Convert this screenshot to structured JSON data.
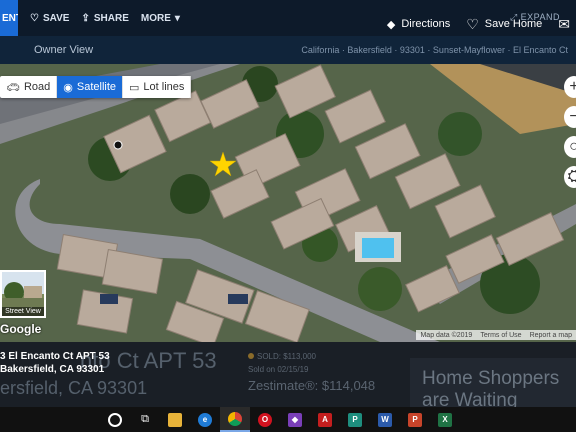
{
  "topbar": {
    "selected_tab": "ENT",
    "tabs": [
      {
        "label": "SAVE",
        "icon": "heart-outline-icon"
      },
      {
        "label": "SHARE",
        "icon": "share-icon"
      },
      {
        "label": "MORE",
        "icon": "chevron-down-icon"
      }
    ],
    "expand_label": "EXPAND",
    "directions_label": "Directions",
    "save_home_label": "Save Home"
  },
  "subbar": {
    "owner_view_label": "Owner View",
    "crumbs": "California · Bakersfield · 93301 · Sunset-Mayflower · El Encanto Ct"
  },
  "map": {
    "map_types": [
      {
        "label": "Road",
        "icon": "car-icon",
        "active": false
      },
      {
        "label": "Satellite",
        "icon": "eye-icon",
        "active": true
      },
      {
        "label": "Lot lines",
        "icon": "lot-lines-icon",
        "active": false
      }
    ],
    "street_view_label": "Street View",
    "google_label": "Google",
    "attribution": [
      "Map data ©2019",
      "Terms of Use",
      "Report a map"
    ]
  },
  "listing": {
    "address_line1": "3 El Encanto Ct APT 53",
    "address_line2": "Bakersfield, CA 93301",
    "headline": "nto Ct APT 53",
    "city_line": "ersfield, CA 93301",
    "sold_label": "SOLD: $113,000",
    "sold_date": "Sold on 02/15/19",
    "zestimate": "Zestimate®: $114,048",
    "shoppers": "Home Shoppers are Waiting"
  },
  "taskbar": {
    "apps": [
      "cortana-icon",
      "task-view-icon",
      "file-explorer-icon",
      "edge-icon",
      "chrome-icon",
      "opera-icon",
      "visual-studio-icon",
      "acrobat-icon",
      "powerpoint-icon",
      "word-icon",
      "powerpoint-icon-2",
      "excel-icon"
    ]
  },
  "colors": {
    "accent": "#1a6bd6",
    "topbar_bg": "#0d1a2a",
    "marker": "#ffd400"
  }
}
